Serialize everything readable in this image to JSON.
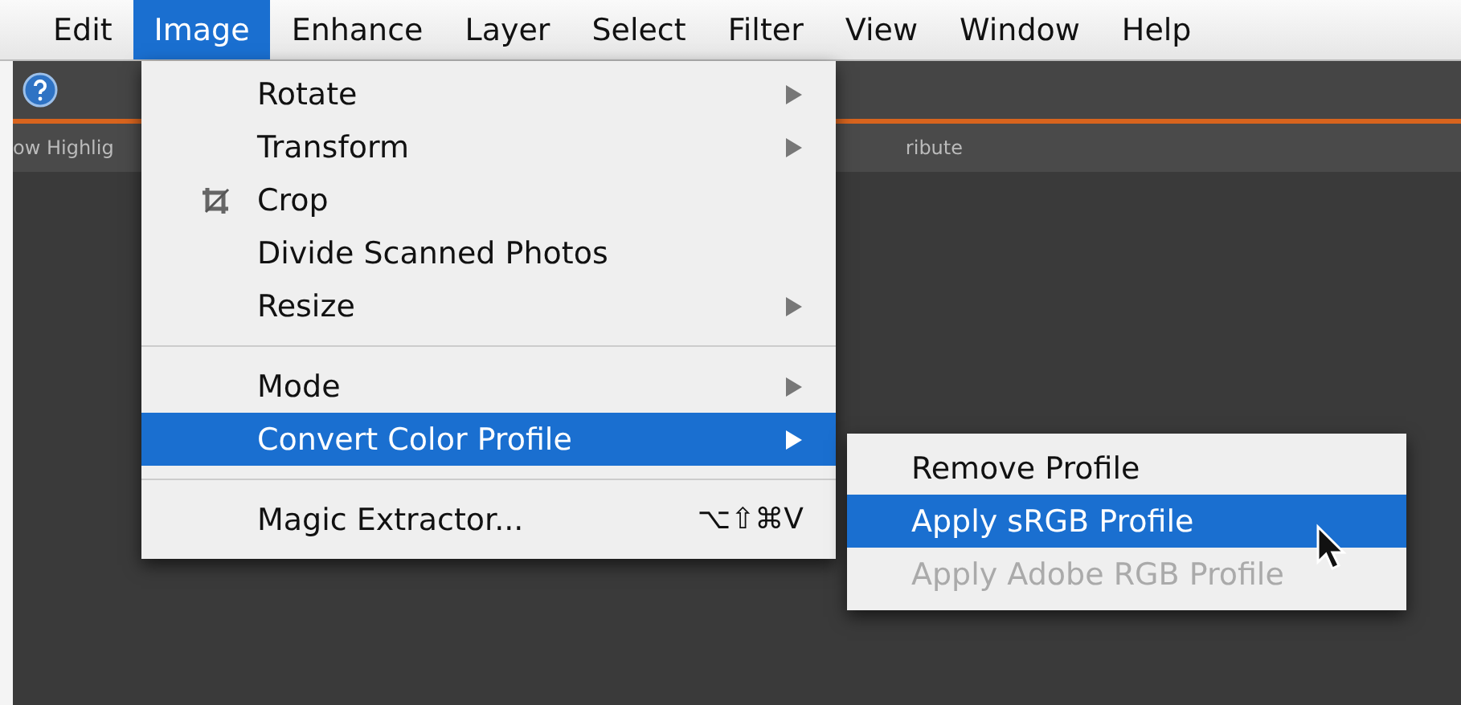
{
  "menu_bar": [
    {
      "label": "Edit",
      "selected": false
    },
    {
      "label": "Image",
      "selected": true
    },
    {
      "label": "Enhance",
      "selected": false
    },
    {
      "label": "Layer",
      "selected": false
    },
    {
      "label": "Select",
      "selected": false
    },
    {
      "label": "Filter",
      "selected": false
    },
    {
      "label": "View",
      "selected": false
    },
    {
      "label": "Window",
      "selected": false
    },
    {
      "label": "Help",
      "selected": false
    }
  ],
  "toolbar": {
    "left_text": "ow Highlig",
    "right_text": "ribute"
  },
  "image_menu": [
    {
      "kind": "item",
      "label": "Rotate",
      "submenu": true,
      "selected": false
    },
    {
      "kind": "item",
      "label": "Transform",
      "submenu": true,
      "selected": false
    },
    {
      "kind": "tool",
      "label": "Crop",
      "submenu": false,
      "selected": false
    },
    {
      "kind": "item",
      "label": "Divide Scanned Photos",
      "submenu": false,
      "selected": false
    },
    {
      "kind": "item",
      "label": "Resize",
      "submenu": true,
      "selected": false
    },
    {
      "kind": "separator"
    },
    {
      "kind": "item",
      "label": "Mode",
      "submenu": true,
      "selected": false
    },
    {
      "kind": "item",
      "label": "Convert Color Profile",
      "submenu": true,
      "selected": true
    },
    {
      "kind": "separator"
    },
    {
      "kind": "item",
      "label": "Magic Extractor...",
      "shortcut": "⌥⇧⌘V",
      "submenu": false,
      "selected": false
    }
  ],
  "profile_submenu": [
    {
      "label": "Remove Profile",
      "selected": false,
      "disabled": false
    },
    {
      "label": "Apply sRGB Profile",
      "selected": true,
      "disabled": false
    },
    {
      "label": "Apply Adobe RGB Profile",
      "selected": false,
      "disabled": true
    }
  ]
}
